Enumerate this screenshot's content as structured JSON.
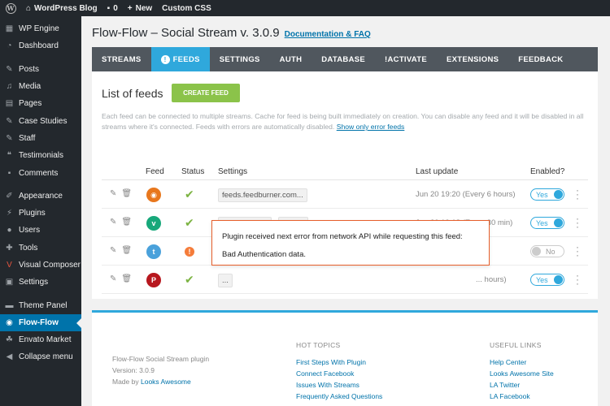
{
  "admin_bar": {
    "site_name": "WordPress Blog",
    "comments_count": "0",
    "new_label": "New",
    "custom_css_label": "Custom CSS"
  },
  "sidebar": {
    "items": [
      {
        "label": "WP Engine",
        "icon": "wp-engine-icon"
      },
      {
        "label": "Dashboard",
        "icon": "dashboard-icon"
      },
      {
        "label": "Posts",
        "icon": "pin-icon"
      },
      {
        "label": "Media",
        "icon": "media-icon"
      },
      {
        "label": "Pages",
        "icon": "pages-icon"
      },
      {
        "label": "Case Studies",
        "icon": "pin-icon"
      },
      {
        "label": "Staff",
        "icon": "pin-icon"
      },
      {
        "label": "Testimonials",
        "icon": "testimonial-icon"
      },
      {
        "label": "Comments",
        "icon": "comments-icon"
      },
      {
        "label": "Appearance",
        "icon": "appearance-icon"
      },
      {
        "label": "Plugins",
        "icon": "plugins-icon"
      },
      {
        "label": "Users",
        "icon": "users-icon"
      },
      {
        "label": "Tools",
        "icon": "tools-icon"
      },
      {
        "label": "Visual Composer",
        "icon": "visual-composer-icon"
      },
      {
        "label": "Settings",
        "icon": "settings-icon"
      },
      {
        "label": "Theme Panel",
        "icon": "theme-panel-icon"
      },
      {
        "label": "Flow-Flow",
        "icon": "flow-flow-icon"
      },
      {
        "label": "Envato Market",
        "icon": "envato-icon"
      },
      {
        "label": "Collapse menu",
        "icon": "collapse-icon"
      }
    ]
  },
  "page": {
    "title": "Flow-Flow – Social Stream v. 3.0.9",
    "doc_link": "Documentation & FAQ"
  },
  "tabs": [
    "STREAMS",
    "FEEDS",
    "SETTINGS",
    "AUTH",
    "DATABASE",
    "!ACTIVATE",
    "EXTENSIONS",
    "FEEDBACK"
  ],
  "feeds_panel": {
    "title": "List of feeds",
    "create_button": "CREATE FEED",
    "description": "Each feed can be connected to multiple streams. Cache for feed is being built immediately on creation. You can disable any feed and it will be disabled in all streams where it's connected. Feeds with errors are automatically disabled.",
    "error_link": "Show only error feeds",
    "columns": {
      "feed": "Feed",
      "status": "Status",
      "settings": "Settings",
      "last_update": "Last update",
      "enabled": "Enabled?"
    },
    "rows": [
      {
        "network": "rss",
        "network_color": "#e8771d",
        "status": "ok",
        "settings": [
          "feeds.feedburner.com..."
        ],
        "last_update": "Jun 20 19:20 (Every 6 hours)",
        "enabled": "Yes"
      },
      {
        "network": "vine",
        "network_color": "#17a87a",
        "status": "ok",
        "settings": [
          "knowthecode",
          "videos"
        ],
        "last_update": "Jun 20 19:18 (Every 30 min)",
        "enabled": "Yes"
      },
      {
        "network": "twitter",
        "network_color": "#4aa1db",
        "status": "error",
        "settings": [],
        "last_update": "",
        "enabled": "No"
      },
      {
        "network": "pinterest",
        "network_color": "#b7171e",
        "status": "ok",
        "settings": [
          "..."
        ],
        "last_update": "... hours)",
        "enabled": "Yes"
      }
    ],
    "tooltip": {
      "line1": "Plugin received next error from network API while requesting this feed:",
      "line2": "Bad Authentication data."
    }
  },
  "footer": {
    "plugin_name": "Flow-Flow Social Stream plugin",
    "version": "Version: 3.0.9",
    "made_by": "Made by",
    "author": "Looks Awesome",
    "hot_topics_title": "HOT TOPICS",
    "hot_topics": [
      "First Steps With Plugin",
      "Connect Facebook",
      "Issues With Streams",
      "Frequently Asked Questions"
    ],
    "useful_links_title": "USEFUL LINKS",
    "useful_links": [
      "Help Center",
      "Looks Awesome Site",
      "LA Twitter",
      "LA Facebook"
    ]
  }
}
